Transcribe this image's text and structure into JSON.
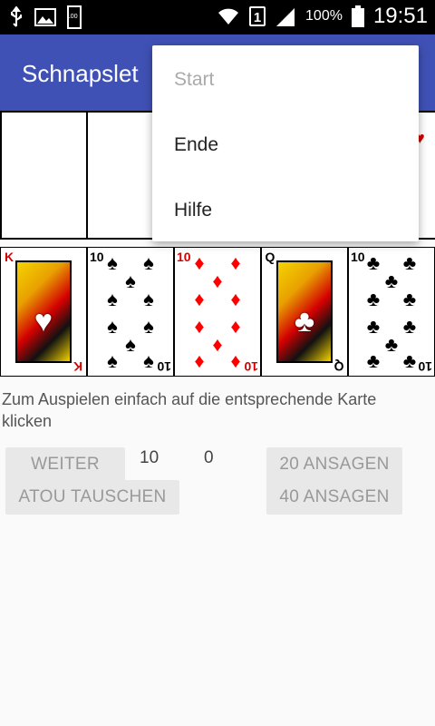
{
  "status_bar": {
    "time": "19:51",
    "battery_pct": "100%",
    "sim": "1",
    "battery_small": "100",
    "icons": [
      "usb-icon",
      "image-icon",
      "battery-full-icon",
      "wifi-icon",
      "signal-icon",
      "battery-icon"
    ]
  },
  "app": {
    "title": "Schnapslet"
  },
  "menu": {
    "items": [
      {
        "label": "Start",
        "enabled": false
      },
      {
        "label": "Ende",
        "enabled": true
      },
      {
        "label": "Hilfe",
        "enabled": true
      }
    ]
  },
  "top_row": {
    "slots": [
      "",
      ""
    ]
  },
  "hand": [
    {
      "rank": "K",
      "suit": "♥",
      "color": "#d40000"
    },
    {
      "rank": "10",
      "suit": "♠",
      "color": "#000000"
    },
    {
      "rank": "10",
      "suit": "♦",
      "color": "#d40000"
    },
    {
      "rank": "Q",
      "suit": "♣",
      "color": "#000000"
    },
    {
      "rank": "10",
      "suit": "♣",
      "color": "#000000"
    }
  ],
  "hint": "Zum Auspielen einfach auf die entsprechende Karte klicken",
  "buttons": {
    "weiter": "WEITER",
    "atou": "ATOU TAUSCHEN",
    "ansagen20": "20 ANSAGEN",
    "ansagen40": "40 ANSAGEN"
  },
  "scores": {
    "player": "10",
    "computer": "0"
  }
}
